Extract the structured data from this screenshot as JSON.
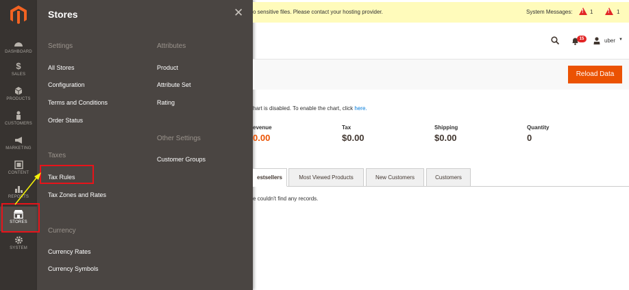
{
  "nav": {
    "items": [
      {
        "key": "dashboard",
        "label": "DASHBOARD",
        "icon": "dashboard-icon"
      },
      {
        "key": "sales",
        "label": "SALES",
        "icon": "dollar-icon"
      },
      {
        "key": "products",
        "label": "PRODUCTS",
        "icon": "cube-icon"
      },
      {
        "key": "customers",
        "label": "CUSTOMERS",
        "icon": "person-icon"
      },
      {
        "key": "marketing",
        "label": "MARKETING",
        "icon": "megaphone-icon"
      },
      {
        "key": "content",
        "label": "CONTENT",
        "icon": "content-icon"
      },
      {
        "key": "reports",
        "label": "REPORTS",
        "icon": "bar-chart-icon"
      },
      {
        "key": "stores",
        "label": "STORES",
        "icon": "store-icon"
      },
      {
        "key": "system",
        "label": "SYSTEM",
        "icon": "gear-icon"
      }
    ]
  },
  "panel": {
    "title": "Stores",
    "settings": {
      "title": "Settings",
      "links": [
        "All Stores",
        "Configuration",
        "Terms and Conditions",
        "Order Status"
      ]
    },
    "taxes": {
      "title": "Taxes",
      "links": [
        "Tax Rules",
        "Tax Zones and Rates"
      ]
    },
    "currency": {
      "title": "Currency",
      "links": [
        "Currency Rates",
        "Currency Symbols"
      ]
    },
    "attributes": {
      "title": "Attributes",
      "links": [
        "Product",
        "Attribute Set",
        "Rating"
      ]
    },
    "other": {
      "title": "Other Settings",
      "links": [
        "Customer Groups"
      ]
    }
  },
  "messages": {
    "text": "o sensitive files. Please contact your hosting provider.",
    "system_label": "System Messages:",
    "count_a": "1",
    "count_b": "1"
  },
  "header": {
    "notifications_count": "15",
    "user_name": "uber",
    "caret": "▼"
  },
  "actions": {
    "reload_label": "Reload Data"
  },
  "dashboard": {
    "chart_note": "hart is disabled. To enable the chart, click ",
    "chart_note_link": "here.",
    "stats": [
      {
        "label": "evenue",
        "value": "0.00"
      },
      {
        "label": "Tax",
        "value": "$0.00"
      },
      {
        "label": "Shipping",
        "value": "$0.00"
      },
      {
        "label": "Quantity",
        "value": "0"
      }
    ],
    "tabs": [
      "estsellers",
      "Most Viewed Products",
      "New Customers",
      "Customers"
    ],
    "no_records": "e couldn't find any records."
  },
  "colors": {
    "accent": "#eb5202",
    "highlight": "#e8131a",
    "arrow": "#f4f10a"
  }
}
